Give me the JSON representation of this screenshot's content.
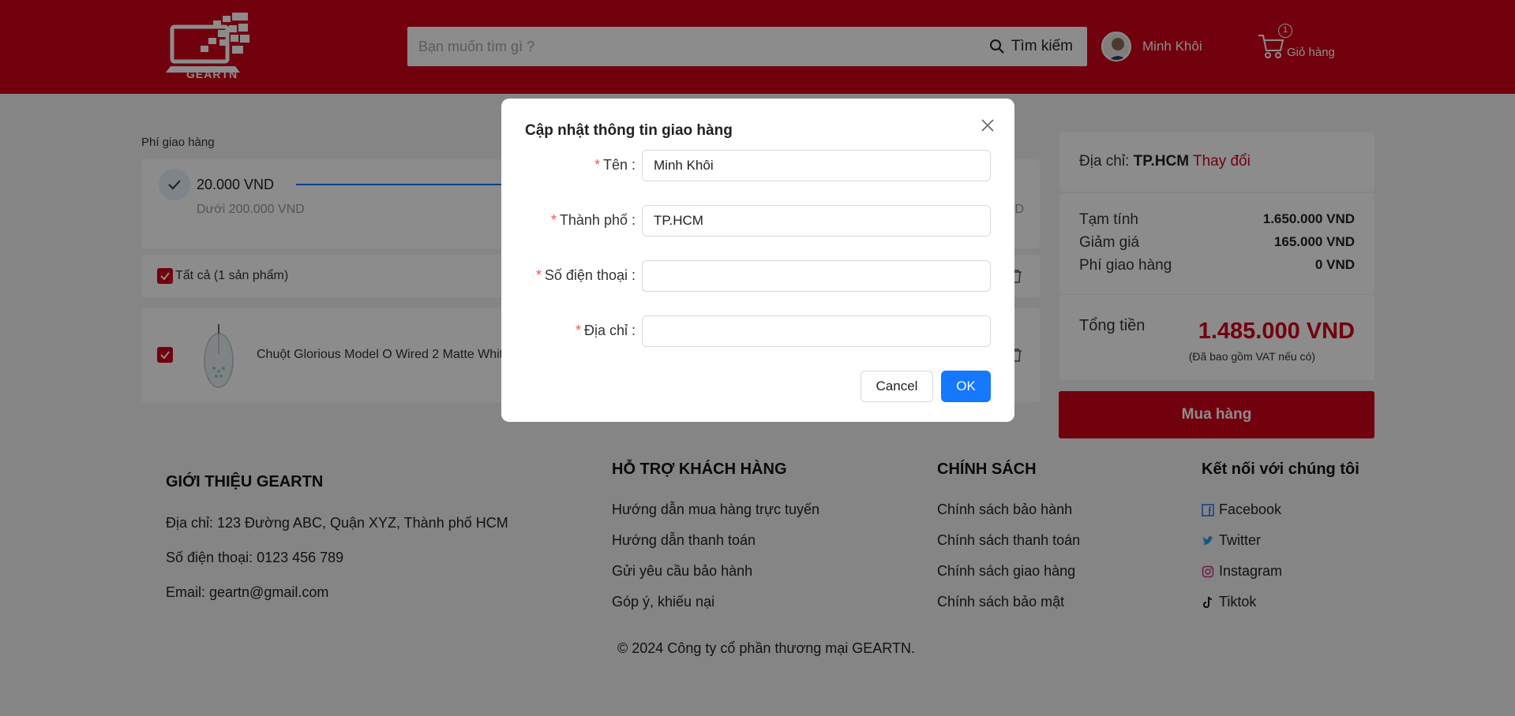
{
  "header": {
    "logo_text": "GEARTN",
    "search_placeholder": "Bạn muốn tìm gì ?",
    "search_button": "Tìm kiếm",
    "user_name": "Minh Khôi",
    "cart_count": "1",
    "cart_label": "Giỏ hàng"
  },
  "shipping": {
    "section_label": "Phí giao hàng",
    "price": "20.000 VND",
    "condition": "Dưới 200.000 VND",
    "right_partial": "D"
  },
  "cart": {
    "select_all_label": "Tất cả (1 sản phẩm)",
    "product_name": "Chuột Glorious Model O Wired 2 Matte White"
  },
  "summary": {
    "address_label": "Địa chỉ:",
    "address_value": "TP.HCM",
    "address_change": "Thay đổi",
    "rows": [
      {
        "label": "Tạm tính",
        "value": "1.650.000 VND"
      },
      {
        "label": "Giảm giá",
        "value": "165.000 VND"
      },
      {
        "label": "Phí giao hàng",
        "value": "0 VND"
      }
    ],
    "total_label": "Tổng tiền",
    "total_value": "1.485.000 VND",
    "total_note": "(Đã bao gồm VAT nếu có)",
    "buy_button": "Mua hàng"
  },
  "footer": {
    "about": {
      "title": "GIỚI THIỆU GEARTN",
      "items": [
        "Địa chỉ: 123 Đường ABC, Quận XYZ, Thành phố HCM",
        "Số điện thoại: 0123 456 789",
        "Email: geartn@gmail.com"
      ]
    },
    "support": {
      "title": "HỖ TRỢ KHÁCH HÀNG",
      "items": [
        "Hướng dẫn mua hàng trực tuyến",
        "Hướng dẫn thanh toán",
        "Gửi yêu cầu bảo hành",
        "Góp ý, khiếu nại"
      ]
    },
    "policy": {
      "title": "CHÍNH SÁCH",
      "items": [
        "Chính sách bảo hành",
        "Chính sách thanh toán",
        "Chính sách giao hàng",
        "Chính sách bảo mật"
      ]
    },
    "social": {
      "title": "Kết nối với chúng tôi",
      "items": [
        {
          "label": "Facebook",
          "icon": "facebook-icon",
          "color": "#1877f2"
        },
        {
          "label": "Twitter",
          "icon": "twitter-icon",
          "color": "#1da1f2"
        },
        {
          "label": "Instagram",
          "icon": "instagram-icon",
          "color": "#c13584"
        },
        {
          "label": "Tiktok",
          "icon": "tiktok-icon",
          "color": "#000000"
        }
      ]
    },
    "copyright": "© 2024 Công ty cổ phần thương mại GEARTN."
  },
  "modal": {
    "title": "Cập nhật thông tin giao hàng",
    "fields": [
      {
        "label": "Tên",
        "value": "Minh Khôi"
      },
      {
        "label": "Thành phố",
        "value": "TP.HCM"
      },
      {
        "label": "Số điện thoại",
        "value": ""
      },
      {
        "label": "Địa chỉ",
        "value": ""
      }
    ],
    "required_mark": "*",
    "cancel": "Cancel",
    "ok": "OK"
  },
  "colors": {
    "brand": "#d0021b",
    "primary": "#1677ff"
  }
}
